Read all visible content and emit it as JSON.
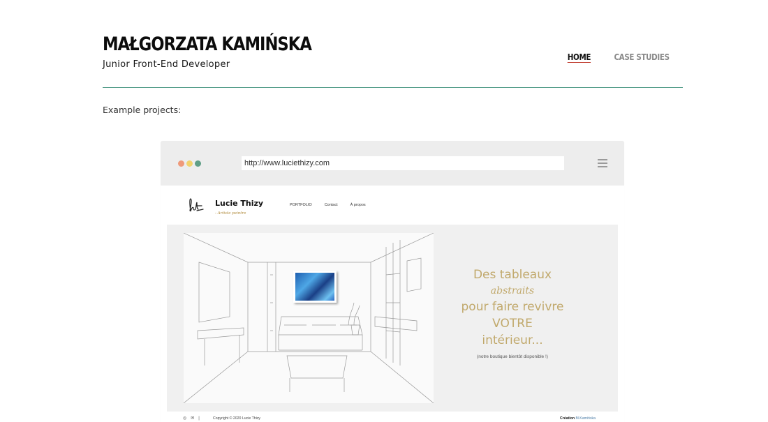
{
  "header": {
    "name": "MAŁGORZATA KAMIŃSKA",
    "role": "Junior Front-End Developer",
    "nav": [
      {
        "label": "HOME",
        "active": true
      },
      {
        "label": "CASE STUDIES",
        "active": false
      }
    ],
    "rule_color": "#4f9a86"
  },
  "intro": {
    "text": "Example projects:"
  },
  "mockup": {
    "browser": {
      "url": "http://www.luciethizy.com",
      "dot_colors": [
        "#ef9a7a",
        "#f2d36b",
        "#5f9e86"
      ],
      "menu_icon": "hamburger-icon"
    },
    "site": {
      "logo_icon": "signature-logo-icon",
      "artist_name": "Lucie Thizy",
      "artist_role": "- Artiste peintre",
      "nav": [
        "PORTFOLIO",
        "Contact",
        "À propos"
      ],
      "hero_lines": [
        "Des tableaux",
        "abstraits",
        "pour faire revivre",
        "VOTRE",
        "intérieur..."
      ],
      "hero_note": "(notre boutique bientôt disponible !)",
      "accent_color": "#c1a96c",
      "footer": {
        "icons": [
          "instagram-icon",
          "email-icon"
        ],
        "separator": "|",
        "copyright": "Copyright © 2020 Lucie Thizy",
        "credit_label": "Création",
        "credit_name": "M.Kamińska"
      }
    }
  }
}
